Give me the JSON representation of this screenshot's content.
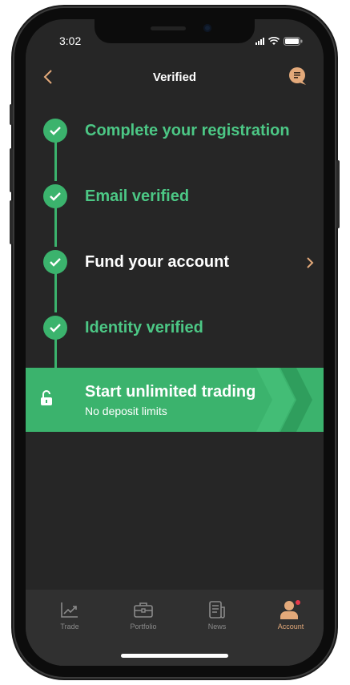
{
  "status_bar": {
    "time": "3:02"
  },
  "header": {
    "title": "Verified"
  },
  "steps": [
    {
      "label": "Complete your registration"
    },
    {
      "label": "Email verified"
    },
    {
      "label": "Fund your account"
    },
    {
      "label": "Identity verified"
    }
  ],
  "banner": {
    "title": "Start unlimited trading",
    "subtitle": "No deposit limits"
  },
  "tabs": [
    {
      "label": "Trade",
      "icon": "chart-icon"
    },
    {
      "label": "Portfolio",
      "icon": "briefcase-icon"
    },
    {
      "label": "News",
      "icon": "news-icon"
    },
    {
      "label": "Account",
      "icon": "account-icon"
    }
  ],
  "active_tab": "Account",
  "colors": {
    "accent_green": "#3bb36d",
    "text_green": "#4cc785",
    "accent_orange": "#e3a97a",
    "background": "#262626",
    "notification_dot": "#e8394b"
  }
}
